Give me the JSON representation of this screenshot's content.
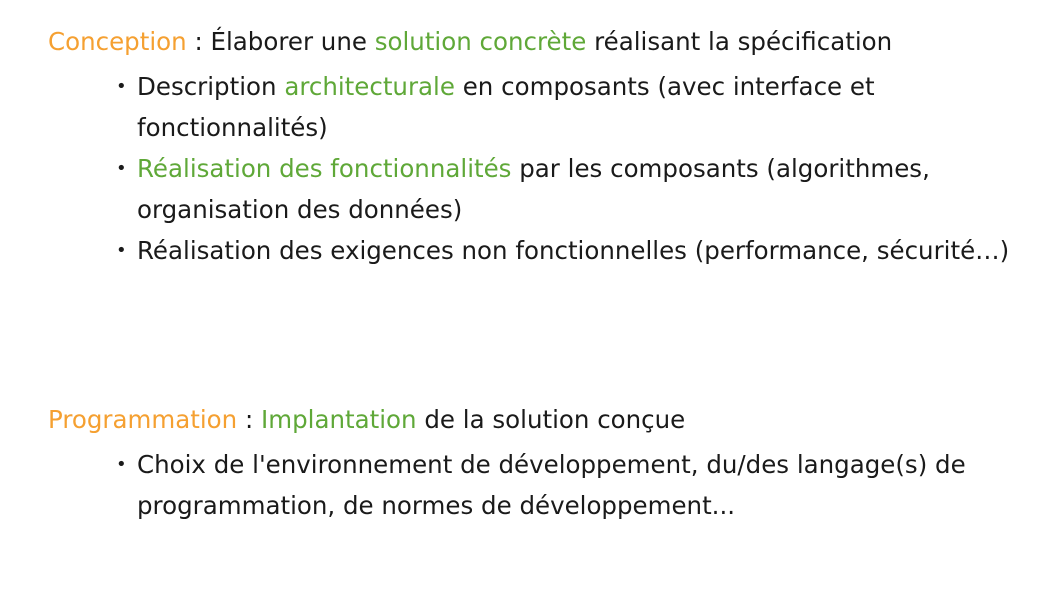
{
  "conception": {
    "term": "Conception",
    "sep": " : ",
    "pre": "Élaborer une ",
    "highlight": "solution concrète",
    "post": " réalisant la spécification",
    "bullets": [
      {
        "pre": "Description ",
        "highlight": "architecturale",
        "post": " en composants (avec interface et fonctionnalités)"
      },
      {
        "pre": "",
        "highlight": "Réalisation des fonctionnalités",
        "post": " par les composants (algorithmes, organisation des données)"
      },
      {
        "pre": "Réalisation des exigences non fonctionnelles (performance, sécurité…)",
        "highlight": "",
        "post": ""
      }
    ]
  },
  "programmation": {
    "term": "Programmation",
    "sep": " : ",
    "highlight": "Implantation",
    "post": " de la solution conçue",
    "bullets": [
      {
        "pre": "Choix de l'environnement de développement, du/des langage(s) de programmation, de normes de développement..."
      }
    ]
  }
}
